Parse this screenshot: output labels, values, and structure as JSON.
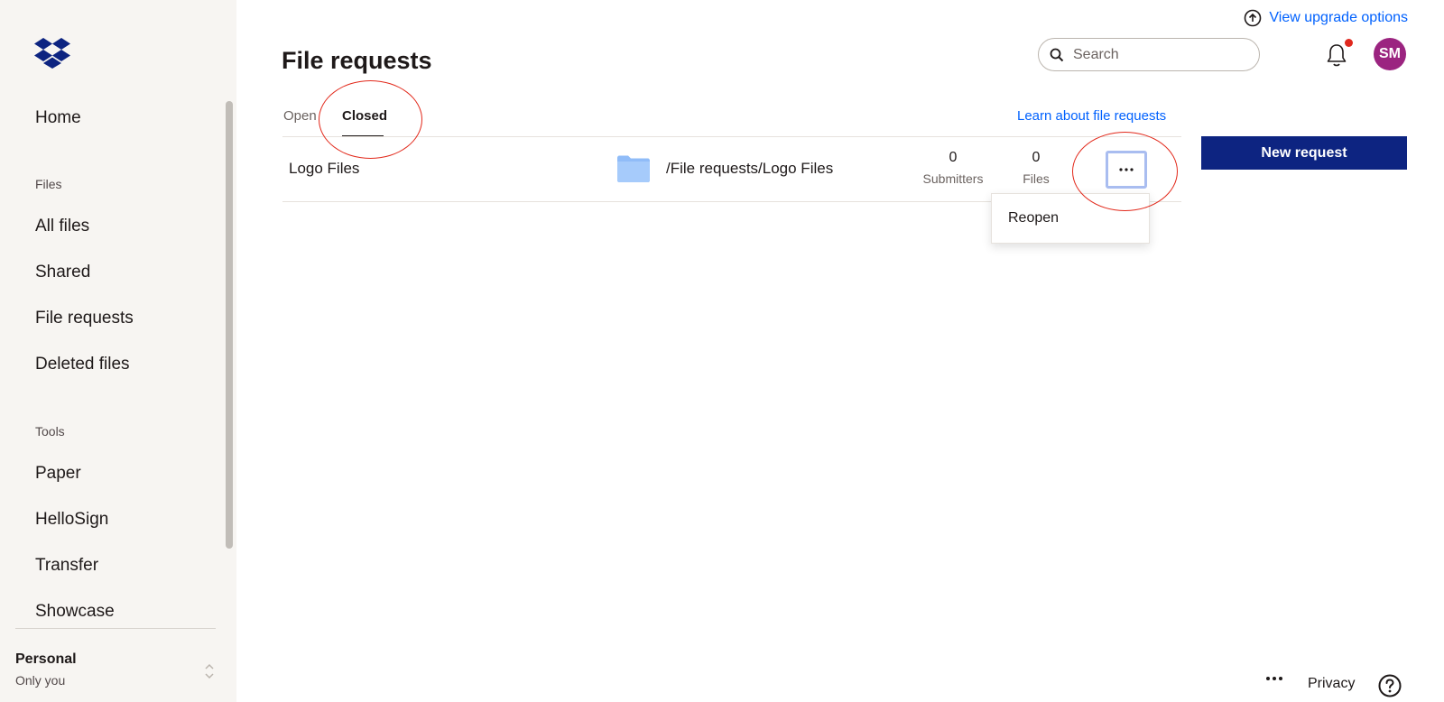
{
  "sidebar": {
    "logo_icon": "dropbox-logo",
    "items": [
      {
        "label": "Home"
      },
      {
        "label": "Files"
      },
      {
        "label": "All files"
      },
      {
        "label": "Shared"
      },
      {
        "label": "File requests"
      },
      {
        "label": "Deleted files"
      },
      {
        "label": "Tools"
      },
      {
        "label": "Paper"
      },
      {
        "label": "HelloSign"
      },
      {
        "label": "Transfer"
      },
      {
        "label": "Showcase"
      }
    ],
    "account": {
      "name": "Personal",
      "sub": "Only you"
    }
  },
  "header": {
    "upgrade_label": "View upgrade options",
    "title": "File requests",
    "search_placeholder": "Search",
    "avatar_initials": "SM",
    "avatar_color": "#9b2480"
  },
  "tabs": [
    {
      "label": "Open"
    },
    {
      "label": "Closed",
      "active": true
    }
  ],
  "learn_link": "Learn about file requests",
  "requests": [
    {
      "name": "Logo Files",
      "path": "/File requests/Logo Files",
      "submitters": "0",
      "submitters_label": "Submitters",
      "files": "0",
      "files_label": "Files"
    }
  ],
  "menu": {
    "items": [
      "Reopen"
    ]
  },
  "new_request_label": "New request",
  "footer": {
    "privacy_label": "Privacy"
  },
  "colors": {
    "accent": "#0061fe",
    "primary_button": "#0d2481",
    "annotation": "#e2291b"
  }
}
